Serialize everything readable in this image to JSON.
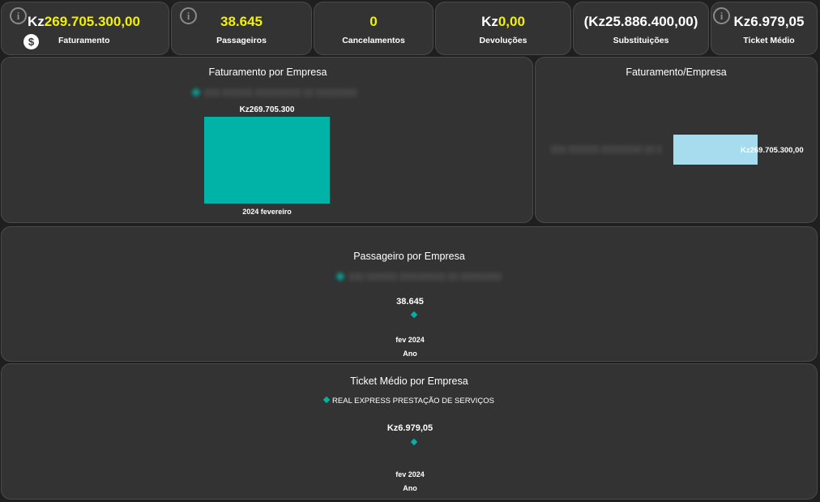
{
  "kpis": {
    "faturamento": {
      "prefix": "Kz",
      "value": "269.705.300,00",
      "label": "Faturamento"
    },
    "passageiros": {
      "value": "38.645",
      "label": "Passageiros"
    },
    "cancelamentos": {
      "value": "0",
      "label": "Cancelamentos"
    },
    "devolucoes": {
      "prefix": "Kz",
      "value": "0,00",
      "label": "Devoluções"
    },
    "substituicoes": {
      "value": "(Kz25.886.400,00)",
      "label": "Substituições"
    },
    "ticket_medio": {
      "value": "Kz6.979,05",
      "label": "Ticket Médio"
    }
  },
  "icons": {
    "info": "info-icon",
    "currency": "dollar-icon"
  },
  "colors": {
    "accent": "#00b3a6",
    "highlight": "#f2f200",
    "bar_light": "#a6dcee",
    "panel": "#333333"
  },
  "panels": {
    "faturamento_por_empresa": {
      "title": "Faturamento por Empresa",
      "bar_label": "Kz269.705.300",
      "category": "2024 fevereiro"
    },
    "faturamento_empresa": {
      "title": "Faturamento/Empresa",
      "bar_label": "Kz269.705.300,00"
    },
    "passageiro_por_empresa": {
      "title": "Passageiro por Empresa",
      "point_label": "38.645",
      "category": "fev 2024",
      "axis_title": "Ano"
    },
    "ticket_medio_por_empresa": {
      "title": "Ticket Médio por Empresa",
      "legend": "REAL EXPRESS PRESTAÇÃO DE SERVIÇOS",
      "point_label": "Kz6.979,05",
      "category": "fev 2024",
      "axis_title": "Ano"
    }
  },
  "chart_data": [
    {
      "type": "bar",
      "title": "Faturamento por Empresa",
      "categories": [
        "2024 fevereiro"
      ],
      "values": [
        269705300
      ]
    },
    {
      "type": "bar",
      "title": "Faturamento/Empresa",
      "orientation": "horizontal",
      "values": [
        269705300
      ]
    },
    {
      "type": "line",
      "title": "Passageiro por Empresa",
      "x": [
        "fev 2024"
      ],
      "values": [
        38645
      ],
      "xlabel": "Ano"
    },
    {
      "type": "line",
      "title": "Ticket Médio por Empresa",
      "x": [
        "fev 2024"
      ],
      "series": [
        {
          "name": "REAL EXPRESS PRESTAÇÃO DE SERVIÇOS",
          "values": [
            6979.05
          ]
        }
      ],
      "xlabel": "Ano"
    }
  ]
}
